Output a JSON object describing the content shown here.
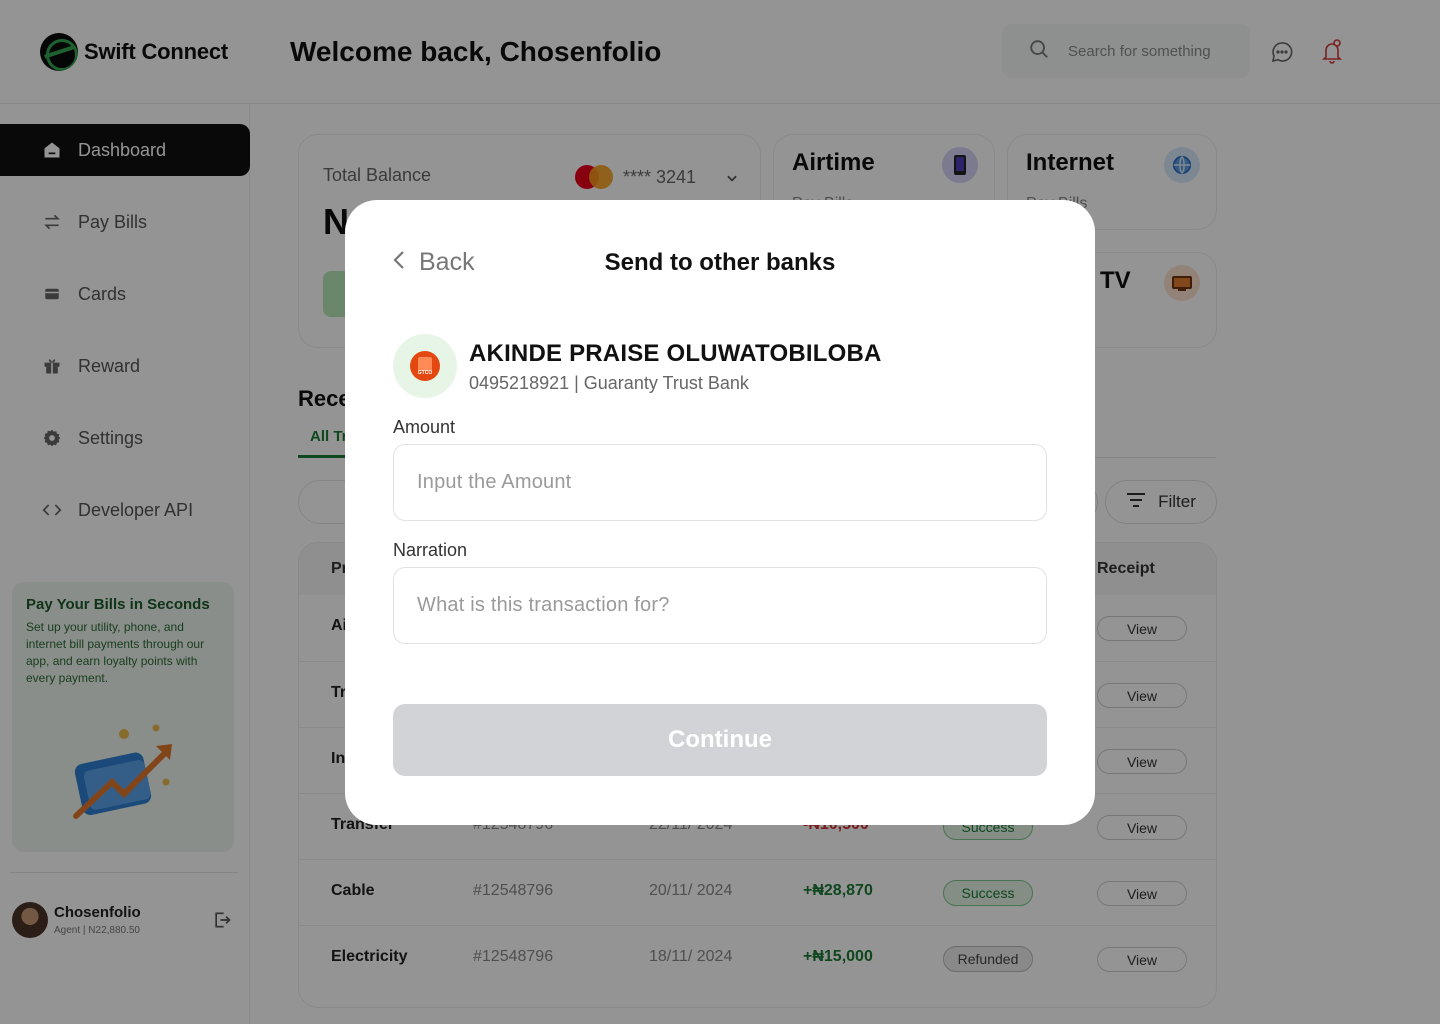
{
  "app": {
    "logo_text": "Swift Connect",
    "welcome": "Welcome back, Chosenfolio"
  },
  "header": {
    "search_placeholder": "Search for something"
  },
  "sidebar": {
    "items": [
      {
        "label": "Dashboard",
        "icon": "home-icon",
        "active": true
      },
      {
        "label": "Pay Bills",
        "icon": "transfer-arrows-icon"
      },
      {
        "label": "Cards",
        "icon": "card-icon"
      },
      {
        "label": "Reward",
        "icon": "gift-icon"
      },
      {
        "label": "Settings",
        "icon": "gear-icon"
      },
      {
        "label": "Developer API",
        "icon": "code-icon"
      }
    ],
    "promo": {
      "title": "Pay Your Bills in Seconds",
      "text": "Set up your utility, phone, and internet bill payments through our app, and earn loyalty points with every payment."
    },
    "profile": {
      "name": "Chosenfolio",
      "sub": "Agent | N22,880.50"
    }
  },
  "balance": {
    "label": "Total Balance",
    "amount_partial": "N",
    "account": "**** 3241"
  },
  "services": [
    {
      "title": "Airtime",
      "sub": "Pay Bills"
    },
    {
      "title": "Internet",
      "sub": "Pay Bills"
    },
    {
      "title": "TV",
      "sub": ""
    }
  ],
  "transactions": {
    "section_title_partial": "Rece",
    "tab_all_partial": "All Tr",
    "filter_label": "Filter",
    "headers": {
      "product_partial": "Pr",
      "receipt": "Receipt"
    },
    "rows": [
      {
        "product": "Ai",
        "id": "",
        "date": "",
        "amount": "",
        "status": "",
        "view": "View"
      },
      {
        "product": "Tr",
        "id": "",
        "date": "",
        "amount": "",
        "status": "",
        "view": "View"
      },
      {
        "product": "In",
        "id": "",
        "date": "",
        "amount": "",
        "status": "",
        "view": "View"
      },
      {
        "product": "Transfer",
        "id": "#12548796",
        "date": "22/11/ 2024",
        "amount": "-₦10,500",
        "status": "Success",
        "view": "View"
      },
      {
        "product": "Cable",
        "id": "#12548796",
        "date": "20/11/ 2024",
        "amount": "+₦28,870",
        "status": "Success",
        "view": "View"
      },
      {
        "product": "Electricity",
        "id": "#12548796",
        "date": "18/11/ 2024",
        "amount": "+₦15,000",
        "status": "Refunded",
        "view": "View"
      }
    ]
  },
  "modal": {
    "back_label": "Back",
    "title": "Send to other banks",
    "recipient_name": "AKINDE PRAISE OLUWATOBILOBA",
    "recipient_account": "0495218921 | Guaranty Trust Bank",
    "amount_label": "Amount",
    "amount_placeholder": "Input the Amount",
    "narration_label": "Narration",
    "narration_placeholder": "What is this transaction for?",
    "continue_label": "Continue"
  },
  "colors": {
    "brand_green": "#1b7a36",
    "overlay": "rgba(0,0,0,0.42)",
    "success_bg": "#e3f5e3",
    "refunded_bg": "#ececec",
    "negative": "#d32f2f",
    "positive": "#1b7a36",
    "button_disabled": "#d1d3d6"
  }
}
